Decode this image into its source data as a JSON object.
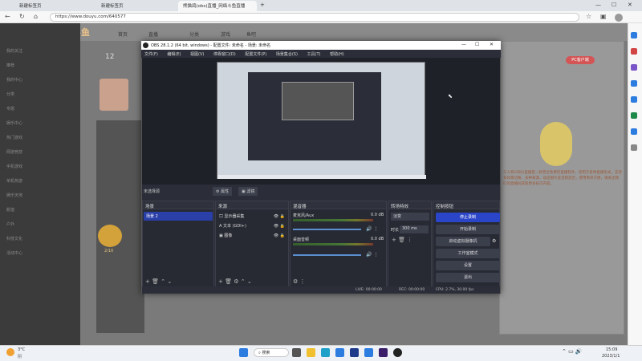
{
  "browser": {
    "tabs": [
      {
        "label": "新建标签页"
      },
      {
        "label": "新建标签页"
      },
      {
        "label": "熊猫鸽(obs)直播_网络斗鱼直播"
      }
    ],
    "url": "https://www.douyu.com/640577"
  },
  "site": {
    "brand": "斗鱼",
    "nav": [
      "首页",
      "直播",
      "分类",
      "游戏",
      "鱼吧"
    ],
    "left_nav": [
      "我的关注",
      "推荐",
      "我的中心",
      "分类",
      "专题",
      "娱乐中心",
      "热门游戏",
      "网游竞技",
      "手机游戏",
      "单机热游",
      "娱乐天地",
      "颜值",
      "户外",
      "科技文化",
      "活动中心"
    ],
    "number_badge": "12",
    "pc_client": "PC客户端",
    "gift_counter": "2/10",
    "right_text": "三人称(OBS)直播是一款完全免费的直播软件，适用于各种直播形式，支持多场景切换、多种来源、动态图片及音频混合，使用简单方便，请关注我们的直播间获取更多技巧内容。"
  },
  "obs": {
    "title": "OBS 28.1.2 (64 bit, windows) - 配置文件: 未命名 - 场景: 未命名",
    "menu": [
      "文件(F)",
      "编辑(E)",
      "视图(V)",
      "停靠窗口(D)",
      "配置文件(P)",
      "场景集合(S)",
      "工具(T)",
      "帮助(H)"
    ],
    "scene_bar": {
      "label": "未选择源",
      "properties": "属性",
      "filters": "滤镜"
    },
    "docks": {
      "scenes": {
        "title": "场景",
        "items": [
          "场景 2"
        ]
      },
      "sources": {
        "title": "来源",
        "items": [
          "显示器采集",
          "文本 (GDI+)",
          "图像"
        ]
      },
      "mixer": {
        "title": "混音器",
        "tracks": [
          {
            "name": "麦克风/Aux",
            "db": "0.0 dB"
          },
          {
            "name": "桌面音频",
            "db": "0.0 dB"
          }
        ]
      },
      "transitions": {
        "title": "转场特效",
        "type": "淡变",
        "duration_label": "时长",
        "duration": "300 ms"
      },
      "controls": {
        "title": "控制按钮",
        "buttons": [
          "停止录制",
          "开始录制",
          "启动虚拟摄像机",
          "工作室模式",
          "设置",
          "退出"
        ]
      }
    },
    "status": {
      "live": "LIVE: 00:00:00",
      "rec": "REC: 00:00:00",
      "cpu": "CPU: 2.7%, 30.00 fps"
    }
  },
  "taskbar": {
    "weather_temp": "3°C",
    "weather_desc": "阴",
    "search": "搜索",
    "time": "15:09",
    "date": "2023/1/1"
  }
}
